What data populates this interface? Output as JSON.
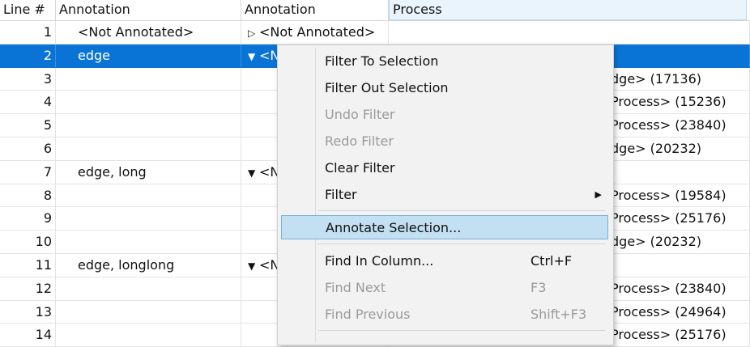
{
  "columns": [
    "Line #",
    "Annotation",
    "Annotation",
    "Process"
  ],
  "rows": [
    {
      "line": "1",
      "annotation": "<Not Annotated>",
      "annotation2": "<Not Annotated>",
      "process": ""
    },
    {
      "line": "2",
      "annotation": "edge",
      "annotation2": "<N",
      "process": ""
    },
    {
      "line": "3",
      "annotation": "",
      "annotation2": "",
      "process": "dge> (17136)"
    },
    {
      "line": "4",
      "annotation": "",
      "annotation2": "",
      "process": "Process> (15236)"
    },
    {
      "line": "5",
      "annotation": "",
      "annotation2": "",
      "process": "Process> (23840)"
    },
    {
      "line": "6",
      "annotation": "",
      "annotation2": "",
      "process": "dge> (20232)"
    },
    {
      "line": "7",
      "annotation": "edge, long",
      "annotation2": "<N",
      "process": ""
    },
    {
      "line": "8",
      "annotation": "",
      "annotation2": "",
      "process": "Process> (19584)"
    },
    {
      "line": "9",
      "annotation": "",
      "annotation2": "",
      "process": "Process> (25176)"
    },
    {
      "line": "10",
      "annotation": "",
      "annotation2": "",
      "process": "dge> (20232)"
    },
    {
      "line": "11",
      "annotation": "edge, longlong",
      "annotation2": "<N",
      "process": ""
    },
    {
      "line": "12",
      "annotation": "",
      "annotation2": "",
      "process": "Process> (23840)"
    },
    {
      "line": "13",
      "annotation": "",
      "annotation2": "",
      "process": "Process> (24964)"
    },
    {
      "line": "14",
      "annotation": "",
      "annotation2": "",
      "process": "Process> (25176)"
    }
  ],
  "menu": {
    "items": [
      {
        "label": "Filter To Selection",
        "shortcut": ""
      },
      {
        "label": "Filter Out Selection",
        "shortcut": ""
      },
      {
        "label": "Undo Filter",
        "shortcut": ""
      },
      {
        "label": "Redo Filter",
        "shortcut": ""
      },
      {
        "label": "Clear Filter",
        "shortcut": ""
      },
      {
        "label": "Filter",
        "shortcut": ""
      },
      {
        "label": "Annotate Selection...",
        "shortcut": ""
      },
      {
        "label": "Find In Column...",
        "shortcut": "Ctrl+F"
      },
      {
        "label": "Find Next",
        "shortcut": "F3"
      },
      {
        "label": "Find Previous",
        "shortcut": "Shift+F3"
      }
    ]
  },
  "colors": {
    "selection": "#0a74d6",
    "menu_highlight": "#c3dff2"
  }
}
